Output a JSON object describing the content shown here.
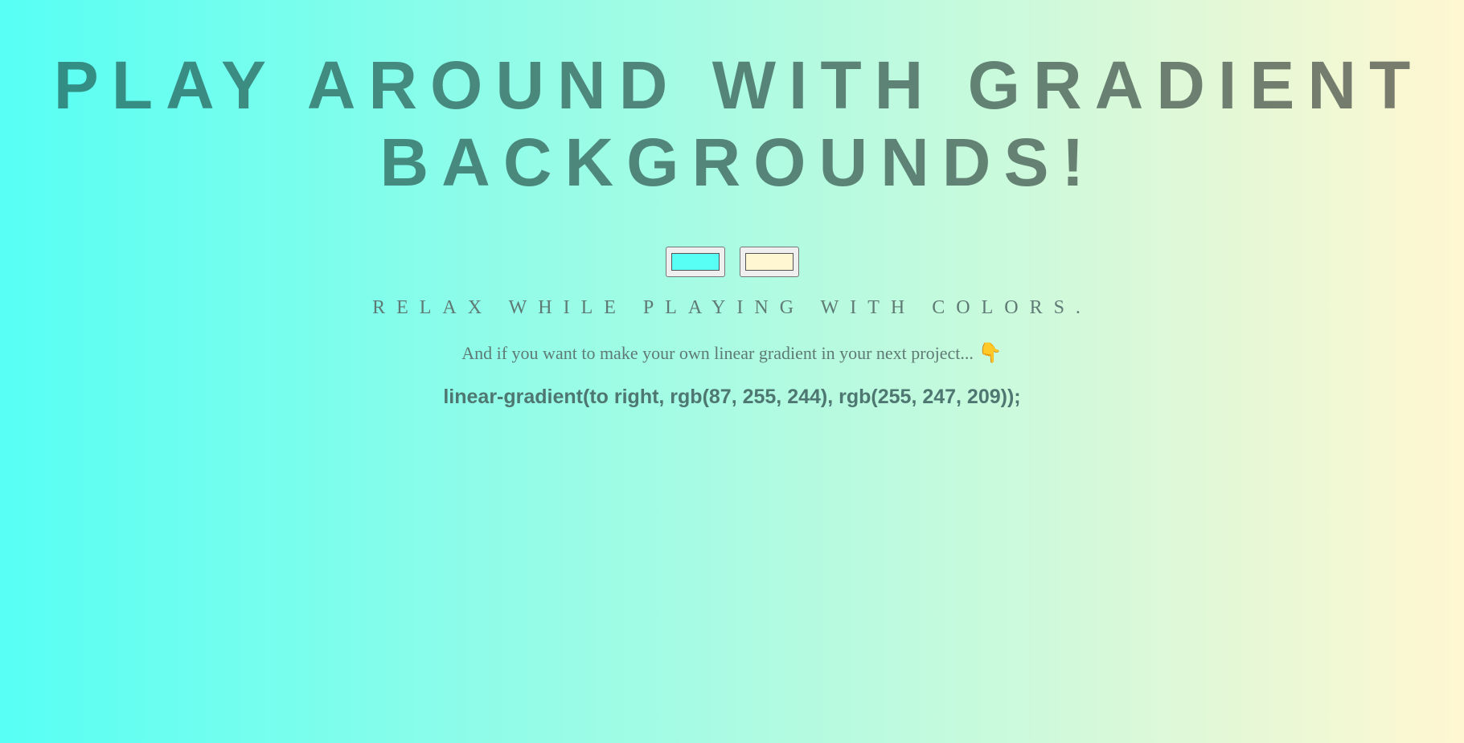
{
  "page": {
    "title_line1": "PLAY AROUND WITH GRADIENT",
    "title_line2": "BACKGROUNDS!",
    "subtitle": "Relax while playing with colors.",
    "intro_text": "And if you want to make your own linear gradient in your next project...",
    "pointing_icon": "👇",
    "css_output": "linear-gradient(to right, rgb(87, 255, 244), rgb(255, 247, 209));"
  },
  "color_pickers": [
    {
      "value": "#57fff4"
    },
    {
      "value": "#fff7d1"
    }
  ],
  "colors": {
    "gradient_start": "#57fff4",
    "gradient_end": "#fff7d1",
    "text": "#5f7a74"
  }
}
